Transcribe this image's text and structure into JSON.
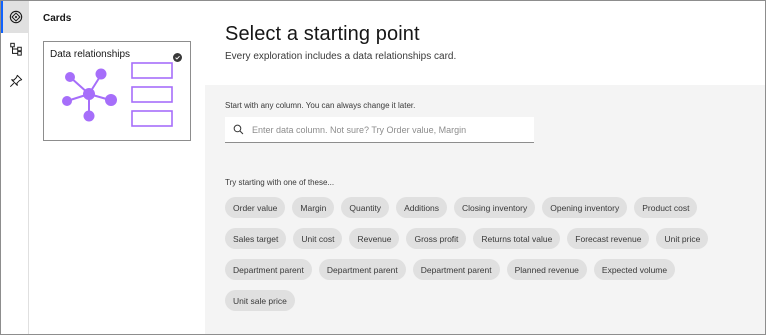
{
  "rail": {
    "icons": [
      "explore-icon",
      "hierarchy-icon",
      "pin-icon"
    ]
  },
  "cards_panel": {
    "title": "Cards",
    "card": {
      "label": "Data relationships",
      "selected": true
    }
  },
  "main": {
    "title": "Select a starting point",
    "subtitle": "Every exploration includes a data relationships card.",
    "start_label": "Start with any column. You can always change it later.",
    "search_placeholder": "Enter data column. Not sure? Try Order value, Margin",
    "try_label": "Try starting with one of these...",
    "suggestions": [
      "Order value",
      "Margin",
      "Quantity",
      "Additions",
      "Closing inventory",
      "Opening inventory",
      "Product cost",
      "Sales target",
      "Unit cost",
      "Revenue",
      "Gross profit",
      "Returns total value",
      "Forecast revenue",
      "Unit price",
      "Department parent",
      "Department parent",
      "Department parent",
      "Planned revenue",
      "Expected volume",
      "Unit sale price"
    ]
  },
  "colors": {
    "accent": "#a66efa",
    "tag_bg": "#e0e0e0",
    "body_bg": "#f4f4f4"
  }
}
